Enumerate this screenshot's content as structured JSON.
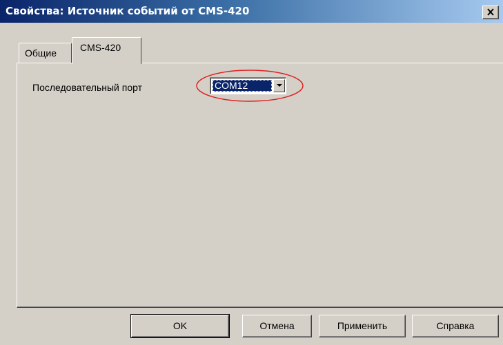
{
  "window": {
    "title": "Свойства: Источник событий от CMS-420"
  },
  "icons": {
    "close": "close-icon",
    "dropdown": "chevron-down-icon"
  },
  "tabs": [
    {
      "label": "Общие",
      "selected": false
    },
    {
      "label": "CMS-420",
      "selected": true
    }
  ],
  "panel": {
    "port_label": "Последовательный порт",
    "port_value": "COM12"
  },
  "buttons": {
    "ok": "OK",
    "cancel": "Отмена",
    "apply": "Применить",
    "help": "Справка"
  },
  "colors": {
    "title_bar": "#0a246a",
    "dialog_bg": "#d4d0c8",
    "selection": "#0a246a",
    "highlight_ellipse": "#e02020"
  }
}
